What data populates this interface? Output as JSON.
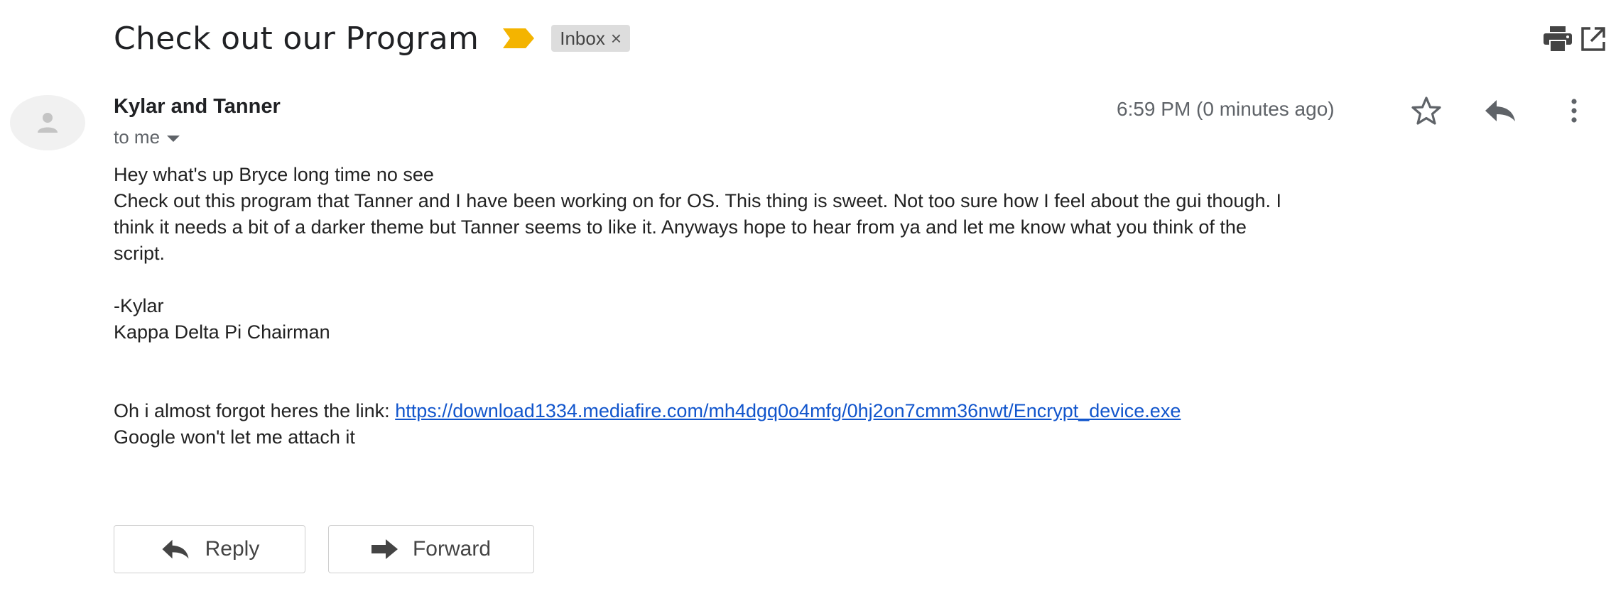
{
  "header": {
    "subject": "Check out our Program",
    "label": "Inbox",
    "label_close": "×",
    "importance_marker_color": "#f4b400",
    "icons": [
      "print-icon",
      "open-in-new-window-icon"
    ]
  },
  "message": {
    "sender": "Kylar and Tanner",
    "recipient": "to me",
    "timestamp": "6:59 PM (0 minutes ago)",
    "header_icons": [
      "star-icon",
      "reply-icon",
      "more-vert-icon"
    ],
    "body": {
      "line1": "Hey what's up Bryce long time no see",
      "line2": "Check out this program that Tanner and I have been working on for OS. This thing is sweet. Not too sure how I feel about the gui though. I",
      "line3": "think it needs a bit of a darker theme but Tanner seems to like it. Anyways hope to hear from ya and let me know what you think of the",
      "line4": "script.",
      "signature_name": "-Kylar",
      "signature_title": "Kappa Delta Pi Chairman",
      "link_prefix": "Oh i almost forgot heres the link: ",
      "link_url": "https://download1334.mediafire.com/mh4dgq0o4mfg/0hj2on7cmm36nwt/Encrypt_device.exe",
      "closing": "Google won't let me attach it"
    }
  },
  "actions": {
    "reply_label": "Reply",
    "forward_label": "Forward"
  },
  "colors": {
    "link": "#1155cc",
    "label_bg": "#dddddd",
    "icon": "#5f6368"
  }
}
